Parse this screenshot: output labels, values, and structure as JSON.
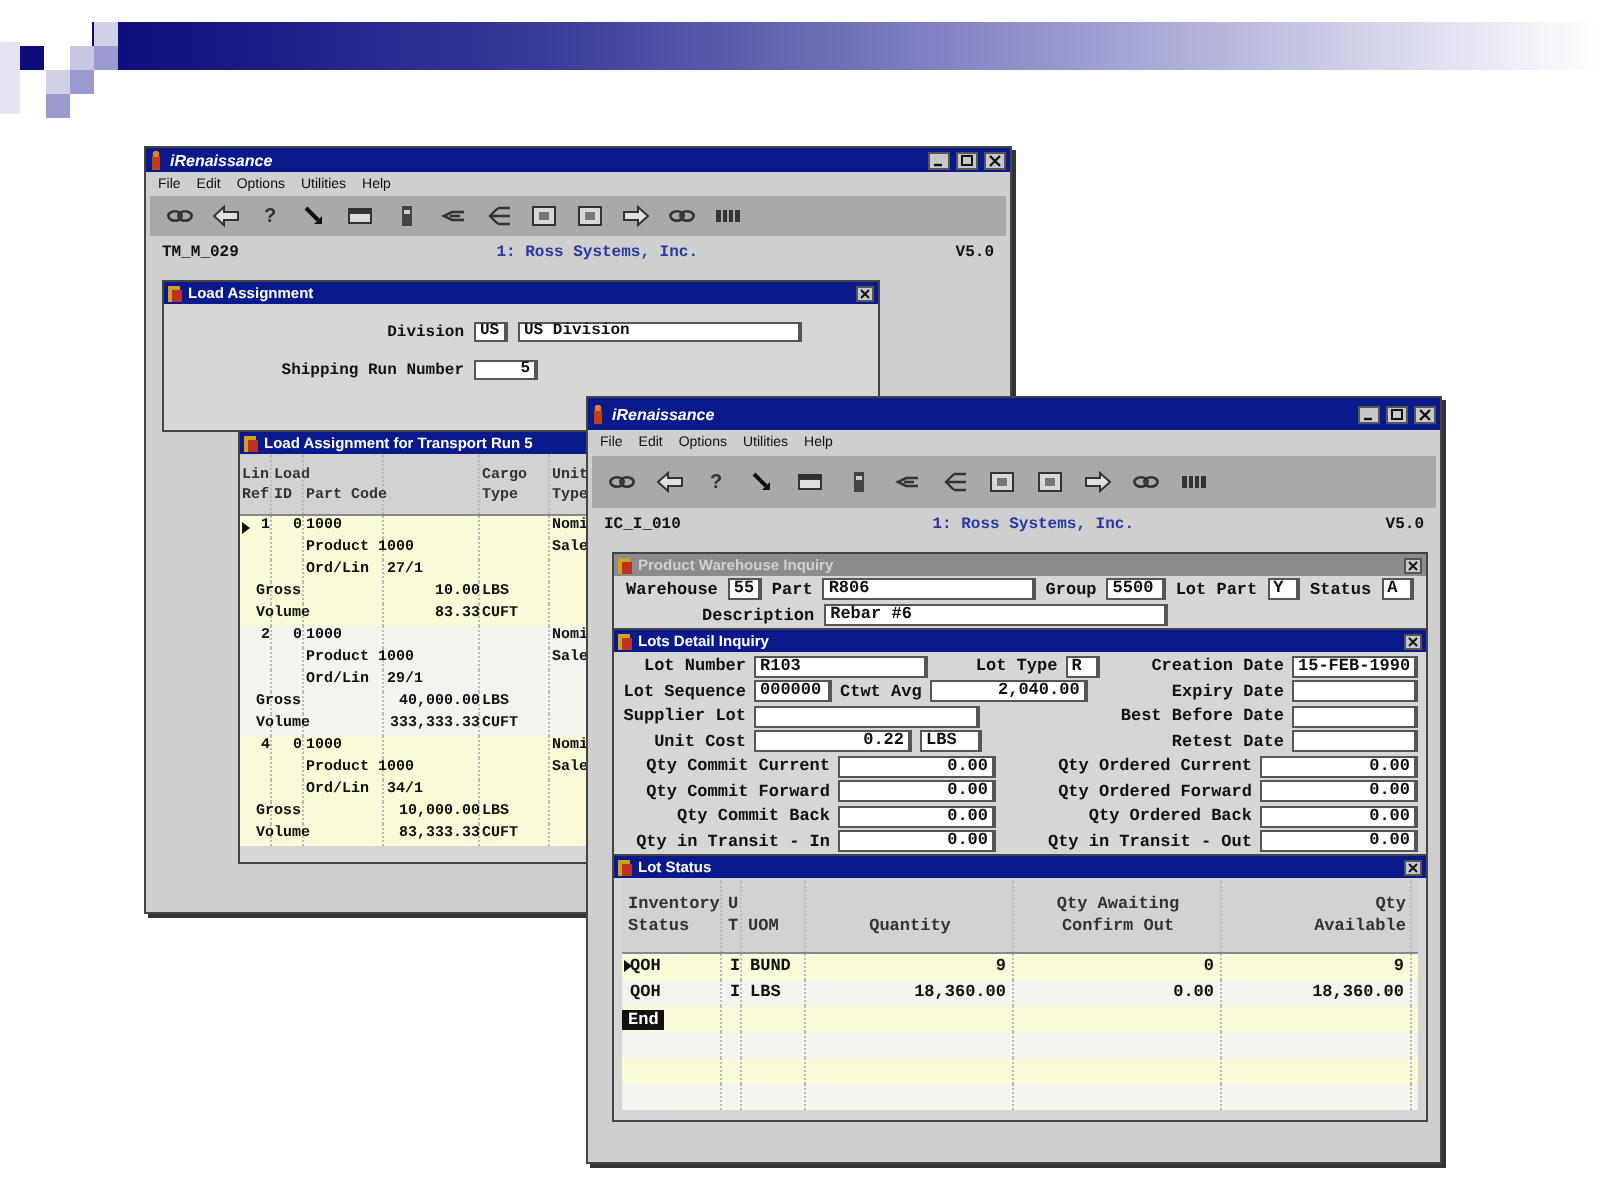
{
  "back_window": {
    "title": "iRenaissance",
    "menu": [
      "File",
      "Edit",
      "Options",
      "Utilities",
      "Help"
    ],
    "toolbar": [
      {
        "kind": "chain"
      },
      {
        "kind": "back"
      },
      {
        "kind": "help",
        "glyph": "?"
      },
      {
        "kind": "pointer"
      },
      {
        "kind": "window"
      },
      {
        "kind": "device"
      },
      {
        "kind": "branch"
      },
      {
        "kind": "tree"
      },
      {
        "kind": "frame"
      },
      {
        "kind": "frame"
      },
      {
        "kind": "forward"
      },
      {
        "kind": "chain"
      },
      {
        "kind": "grid"
      }
    ],
    "screen_id": "TM_M_029",
    "company": "1: Ross Systems, Inc.",
    "version": "V5.0",
    "load_assignment": {
      "title": "Load Assignment",
      "active": true,
      "division": {
        "label": "Division",
        "code": "US",
        "value": "US Division"
      },
      "run_number": {
        "label": "Shipping Run Number",
        "value": "5"
      }
    },
    "transport_grid": {
      "title": "Load Assignment for Transport Run 5",
      "active": true,
      "columns": [
        {
          "kind": "ref",
          "top": "Lin",
          "bottom": "Ref"
        },
        {
          "kind": "load",
          "top": "Load",
          "bottom": "ID"
        },
        {
          "kind": "part",
          "bottom": "Part Code"
        },
        {
          "kind": "cargo",
          "top": "Cargo",
          "bottom": "Type"
        },
        {
          "kind": "unit",
          "top": "Unit",
          "bottom": "Type"
        }
      ],
      "rows": [
        {
          "kind": "item",
          "ref": "1",
          "load": "0",
          "part": "1000",
          "unit_type": "Nomi",
          "current": true
        },
        {
          "kind": "detail",
          "text": "Product 1000",
          "unit_type": "Sale"
        },
        {
          "kind": "detail",
          "text": "Ord/Lin  27/1"
        },
        {
          "kind": "measure",
          "label": "Gross",
          "value": "10.00",
          "unit": "LBS"
        },
        {
          "kind": "measure",
          "label": "Volume",
          "value": "83.33",
          "unit": "CUFT"
        },
        {
          "kind": "item",
          "ref": "2",
          "load": "0",
          "part": "1000",
          "unit_type": "Nomi",
          "current": false
        },
        {
          "kind": "detail",
          "text": "Product 1000",
          "unit_type": "Sale"
        },
        {
          "kind": "detail",
          "text": "Ord/Lin  29/1"
        },
        {
          "kind": "measure",
          "label": "Gross",
          "value": "40,000.00",
          "unit": "LBS"
        },
        {
          "kind": "measure",
          "label": "Volume",
          "value": "333,333.33",
          "unit": "CUFT"
        },
        {
          "kind": "item",
          "ref": "4",
          "load": "0",
          "part": "1000",
          "unit_type": "Nomi",
          "current": false
        },
        {
          "kind": "detail",
          "text": "Product 1000",
          "unit_type": "Sale"
        },
        {
          "kind": "detail",
          "text": "Ord/Lin  34/1"
        },
        {
          "kind": "measure",
          "label": "Gross",
          "value": "10,000.00",
          "unit": "LBS"
        },
        {
          "kind": "measure",
          "label": "Volume",
          "value": "83,333.33",
          "unit": "CUFT"
        }
      ]
    }
  },
  "front_window": {
    "title": "iRenaissance",
    "menu": [
      "File",
      "Edit",
      "Options",
      "Utilities",
      "Help"
    ],
    "toolbar": [
      {
        "kind": "chain"
      },
      {
        "kind": "back"
      },
      {
        "kind": "help",
        "glyph": "?"
      },
      {
        "kind": "pointer"
      },
      {
        "kind": "window"
      },
      {
        "kind": "device"
      },
      {
        "kind": "branch"
      },
      {
        "kind": "tree"
      },
      {
        "kind": "frame"
      },
      {
        "kind": "frame"
      },
      {
        "kind": "forward"
      },
      {
        "kind": "chain"
      },
      {
        "kind": "grid"
      }
    ],
    "screen_id": "IC_I_010",
    "company": "1: Ross Systems, Inc.",
    "version": "V5.0",
    "product_inquiry": {
      "title": "Product Warehouse Inquiry",
      "active": false,
      "lines": [
        {
          "items": [
            {
              "kind": "label",
              "text": "Warehouse"
            },
            {
              "kind": "code",
              "value": "55"
            },
            {
              "kind": "label",
              "text": "Part"
            },
            {
              "kind": "wide",
              "value": "R806"
            },
            {
              "kind": "label",
              "text": "Group"
            },
            {
              "kind": "short",
              "value": "5500"
            },
            {
              "kind": "label",
              "text": "Lot Part"
            },
            {
              "kind": "code",
              "value": "Y"
            },
            {
              "kind": "label",
              "text": "Status"
            },
            {
              "kind": "code",
              "value": "A"
            }
          ]
        },
        {
          "items": [
            {
              "kind": "label",
              "text": "Description"
            },
            {
              "kind": "xwide",
              "value": "Rebar #6"
            }
          ]
        }
      ]
    },
    "lots_detail": {
      "title": "Lots Detail Inquiry",
      "active": true,
      "rows": [
        {
          "left": [
            {
              "kind": "llabel",
              "text": "Lot Number"
            },
            {
              "kind": "long",
              "value": "R103"
            }
          ],
          "right": [
            {
              "kind": "label",
              "text": "Lot Type"
            },
            {
              "kind": "code",
              "value": "R"
            },
            {
              "kind": "gap"
            },
            {
              "kind": "label",
              "text": "Creation Date"
            },
            {
              "kind": "date",
              "value": "15-FEB-1990"
            }
          ]
        },
        {
          "left": [
            {
              "kind": "llabel",
              "text": "Lot Sequence"
            },
            {
              "kind": "seq",
              "value": "000000"
            },
            {
              "kind": "label",
              "text": "Ctwt Avg"
            },
            {
              "kind": "amount",
              "value": "2,040.00"
            }
          ],
          "right": [
            {
              "kind": "label",
              "text": "Expiry Date"
            },
            {
              "kind": "date"
            }
          ]
        },
        {
          "left": [
            {
              "kind": "llabel",
              "text": "Supplier Lot"
            },
            {
              "kind": "wide"
            }
          ],
          "right": [
            {
              "kind": "label",
              "text": "Best Before Date"
            },
            {
              "kind": "date"
            }
          ]
        },
        {
          "left": [
            {
              "kind": "llabel",
              "text": "Unit Cost"
            },
            {
              "kind": "amount",
              "value": "0.22"
            },
            {
              "kind": "short",
              "value": "LBS"
            }
          ],
          "right": [
            {
              "kind": "label",
              "text": "Retest Date"
            },
            {
              "kind": "date"
            }
          ]
        },
        {
          "left": [
            {
              "kind": "qlabel",
              "text": "Qty Commit Current"
            },
            {
              "kind": "amount",
              "value": "0.00"
            }
          ],
          "right": [
            {
              "kind": "qlabel",
              "text": "Qty Ordered Current"
            },
            {
              "kind": "amount",
              "value": "0.00"
            }
          ]
        },
        {
          "left": [
            {
              "kind": "qlabel",
              "text": "Qty Commit Forward"
            },
            {
              "kind": "amount",
              "value": "0.00"
            }
          ],
          "right": [
            {
              "kind": "qlabel",
              "text": "Qty Ordered Forward"
            },
            {
              "kind": "amount",
              "value": "0.00"
            }
          ]
        },
        {
          "left": [
            {
              "kind": "qlabel",
              "text": "Qty Commit Back"
            },
            {
              "kind": "amount",
              "value": "0.00"
            }
          ],
          "right": [
            {
              "kind": "qlabel",
              "text": "Qty Ordered Back"
            },
            {
              "kind": "amount",
              "value": "0.00"
            }
          ]
        },
        {
          "left": [
            {
              "kind": "qlabel",
              "text": "Qty in Transit - In"
            },
            {
              "kind": "amount",
              "value": "0.00"
            }
          ],
          "right": [
            {
              "kind": "qlabel",
              "text": "Qty in Transit - Out"
            },
            {
              "kind": "amount",
              "value": "0.00"
            }
          ]
        }
      ]
    },
    "lot_status": {
      "title": "Lot Status",
      "active": true,
      "columns": [
        {
          "kind": "text",
          "top": "Inventory",
          "bottom": "Status"
        },
        {
          "kind": "text",
          "top": "U",
          "bottom": "T"
        },
        {
          "kind": "text",
          "bottom": "UOM"
        },
        {
          "kind": "number",
          "bottom": "Quantity"
        },
        {
          "kind": "number",
          "top": "Qty Awaiting",
          "bottom": "Confirm Out"
        },
        {
          "kind": "number",
          "top": "Qty",
          "bottom": "Available"
        }
      ],
      "rows": [
        {
          "cells": [
            "QOH",
            "I",
            "BUND",
            "9",
            "0",
            "9"
          ],
          "current": true
        },
        {
          "cells": [
            "QOH",
            "I",
            "LBS",
            "18,360.00",
            "0.00",
            "18,360.00"
          ],
          "current": false
        }
      ],
      "end_marker": "End"
    }
  }
}
